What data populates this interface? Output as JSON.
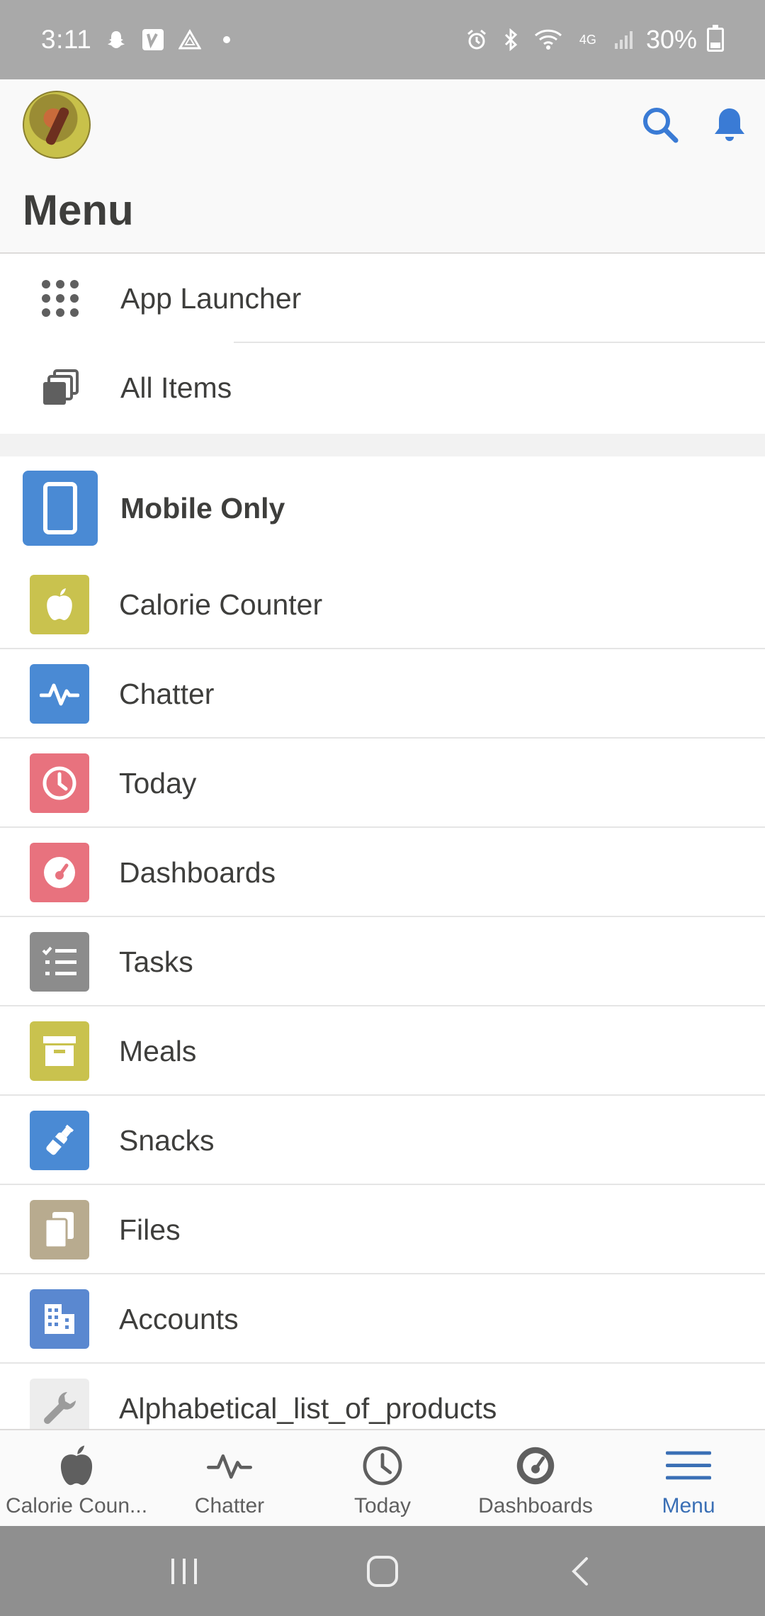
{
  "status_bar": {
    "time": "3:11",
    "battery": "30%",
    "left_icons": [
      "snapchat-icon",
      "venmo-icon",
      "drive-icon",
      "dot-icon"
    ],
    "right_icons": [
      "alarm-icon",
      "bluetooth-icon",
      "wifi-icon",
      "lte-icon",
      "signal-icon",
      "battery-icon"
    ]
  },
  "header": {
    "title": "Menu",
    "search_icon": "search-icon",
    "notifications_icon": "bell-icon"
  },
  "top_items": [
    {
      "label": "App Launcher",
      "icon": "app-launcher-icon"
    },
    {
      "label": "All Items",
      "icon": "all-items-icon"
    }
  ],
  "app": {
    "name": "Mobile Only",
    "icon": "mobile-icon",
    "color": "#4a8ad4"
  },
  "items": [
    {
      "label": "Calorie Counter",
      "icon": "apple-icon",
      "color": "#c9c24e"
    },
    {
      "label": "Chatter",
      "icon": "pulse-icon",
      "color": "#4a8ad4"
    },
    {
      "label": "Today",
      "icon": "clock-icon",
      "color": "#e8727e"
    },
    {
      "label": "Dashboards",
      "icon": "gauge-icon",
      "color": "#e8727e"
    },
    {
      "label": "Tasks",
      "icon": "checklist-icon",
      "color": "#8c8c8c"
    },
    {
      "label": "Meals",
      "icon": "archive-icon",
      "color": "#c9c24e"
    },
    {
      "label": "Snacks",
      "icon": "bottle-icon",
      "color": "#4a8ad4"
    },
    {
      "label": "Files",
      "icon": "files-icon",
      "color": "#b8ab8f"
    },
    {
      "label": "Accounts",
      "icon": "building-icon",
      "color": "#5a88d0"
    },
    {
      "label": "Alphabetical_list_of_products",
      "icon": "wrench-icon",
      "color": "#ededed"
    }
  ],
  "bottom_nav": [
    {
      "label": "Calorie Coun...",
      "icon": "apple-icon",
      "active": false
    },
    {
      "label": "Chatter",
      "icon": "pulse-icon",
      "active": false
    },
    {
      "label": "Today",
      "icon": "clock-icon",
      "active": false
    },
    {
      "label": "Dashboards",
      "icon": "gauge-icon",
      "active": false
    },
    {
      "label": "Menu",
      "icon": "menu-icon",
      "active": true
    }
  ],
  "system_nav": [
    "recents-button",
    "home-button",
    "back-button"
  ]
}
